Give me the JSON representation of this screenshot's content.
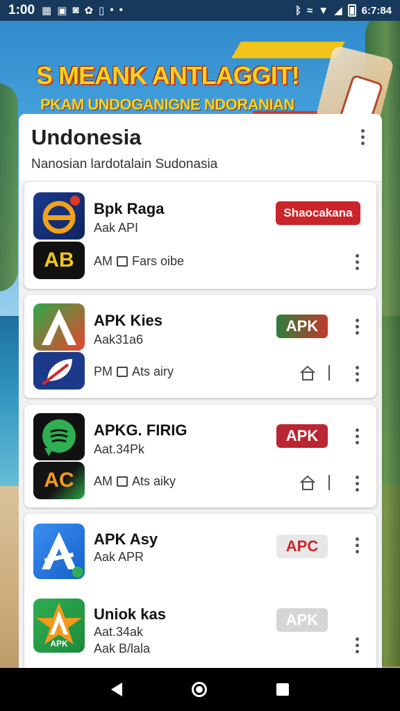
{
  "status_bar": {
    "time": "1:00",
    "left_icons": [
      "grid-icon",
      "image-icon",
      "media-icon",
      "bug-icon",
      "sd-card-icon",
      "dot-icon",
      "dot-icon"
    ],
    "right_text": "6:7:84",
    "right_icons": [
      "bluetooth-icon",
      "wifi-calling-icon",
      "wifi-icon",
      "signal-icon",
      "battery-icon"
    ]
  },
  "banner": {
    "title": "S MEANK ANTLAGGIT!",
    "subtitle": "PKAM UNDOGANIGNE NDORANIAN"
  },
  "header": {
    "title": "Undonesia",
    "subtitle": "Nanosian lardotalain Sudonasia"
  },
  "apps": [
    {
      "name": "Bpk Raga",
      "meta": "Aak API",
      "badge": "Shaocakana",
      "badge_color": "#c9252a",
      "second_icon_text": "AB",
      "row2": "AM",
      "row2_detail": "Fars oibe"
    },
    {
      "name": "APK Kies",
      "meta": "Aak31a6",
      "badge": "APK",
      "badge_color": "#c03a2b",
      "row2": "PM",
      "row2_detail": "Ats airy"
    },
    {
      "name": "APKG. FIRIG",
      "meta": "Aat.34Pk",
      "badge": "APK",
      "badge_color": "#b92632",
      "second_icon_text": "AC",
      "row2": "AM",
      "row2_detail": "Ats aiky"
    },
    {
      "name": "APK Asy",
      "meta": "Aak APR",
      "badge": "APC",
      "badge_color": "#e7e7e7",
      "badge_text_color": "#c9252a"
    },
    {
      "name": "Uniok kas",
      "meta": "Aat.34ak",
      "meta2": "Aak B/lala",
      "badge": "APK",
      "badge_color": "#d5d5d5",
      "icon_label": "APK"
    }
  ],
  "nav": {
    "back": "back-icon",
    "home": "home-icon",
    "recent": "recents-icon"
  }
}
